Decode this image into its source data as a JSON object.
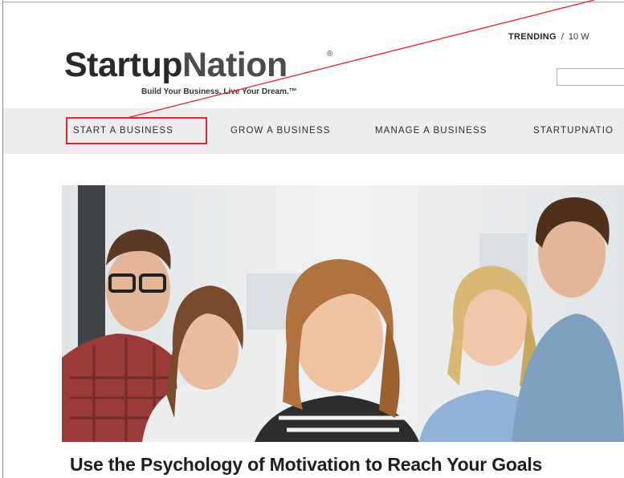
{
  "header": {
    "trending_label": "TRENDING",
    "trending_separator": "/",
    "trending_item": "10 W",
    "search_placeholder": ""
  },
  "logo": {
    "name_part1": "Startup",
    "name_part2": "Nation",
    "registered_mark": "®",
    "tagline": "Build Your Business. Live Your Dream.™"
  },
  "nav": {
    "items": [
      {
        "label": "START A BUSINESS"
      },
      {
        "label": "GROW A BUSINESS"
      },
      {
        "label": "MANAGE A BUSINESS"
      },
      {
        "label": "STARTUPNATIO"
      }
    ]
  },
  "article": {
    "title": "Use the Psychology of Motivation to Reach Your Goals"
  },
  "annotation": {
    "color": "#e3262b"
  }
}
